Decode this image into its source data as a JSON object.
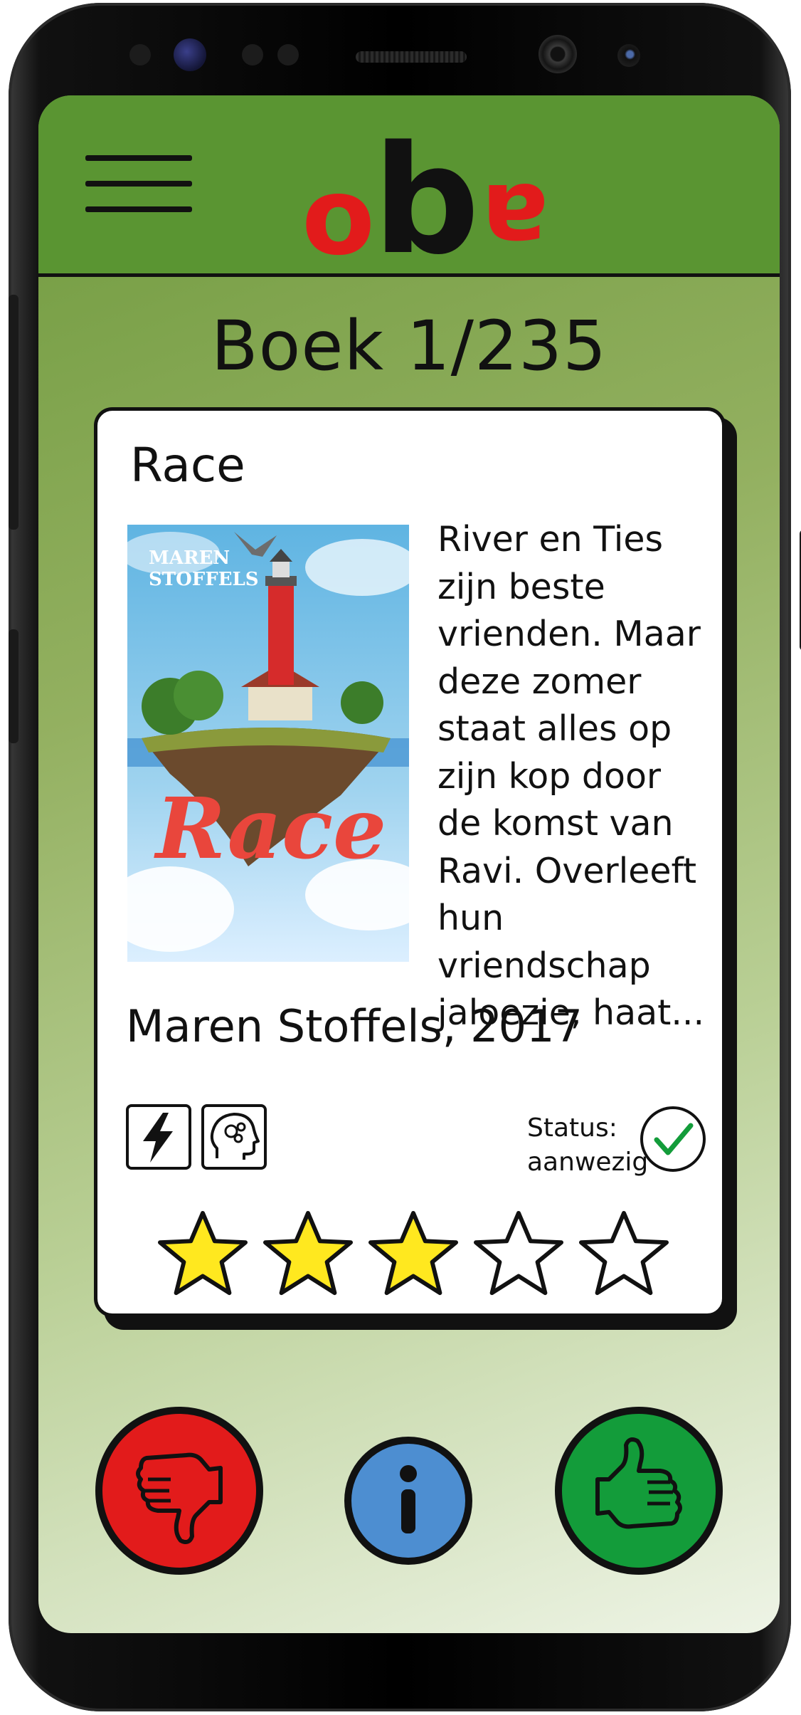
{
  "app": {
    "logo_letters": [
      "o",
      "b",
      "a"
    ],
    "colors": {
      "header": "#5a9532",
      "logo_red": "#e21b1b",
      "dislike": "#e21b1b",
      "info": "#4d8ed1",
      "like": "#139c3a",
      "star_filled": "#ffe81f"
    }
  },
  "header": {
    "menu_icon": "hamburger-menu-icon"
  },
  "page": {
    "title": "Boek 1/235"
  },
  "book": {
    "title": "Race",
    "cover_author": "MAREN\nSTOFFELS",
    "cover_title": "Race",
    "description": "River en Ties\nzijn beste\nvrienden. Maar\ndeze zomer\nstaat alles op\nzijn kop door\nde komst van\nRavi. Overleeft\nhun vriendschap\njaloezie, haat...",
    "author_year": "Maren Stoffels, 2017",
    "genres": [
      "lightning-icon",
      "thinking-head-icon"
    ],
    "status_line1": "Status:",
    "status_line2": "aanwezig",
    "status_icon": "check-circle-icon",
    "rating": 3,
    "rating_max": 5
  },
  "actions": {
    "dislike_icon": "thumbs-down-icon",
    "info_icon": "info-icon",
    "like_icon": "thumbs-up-icon"
  }
}
